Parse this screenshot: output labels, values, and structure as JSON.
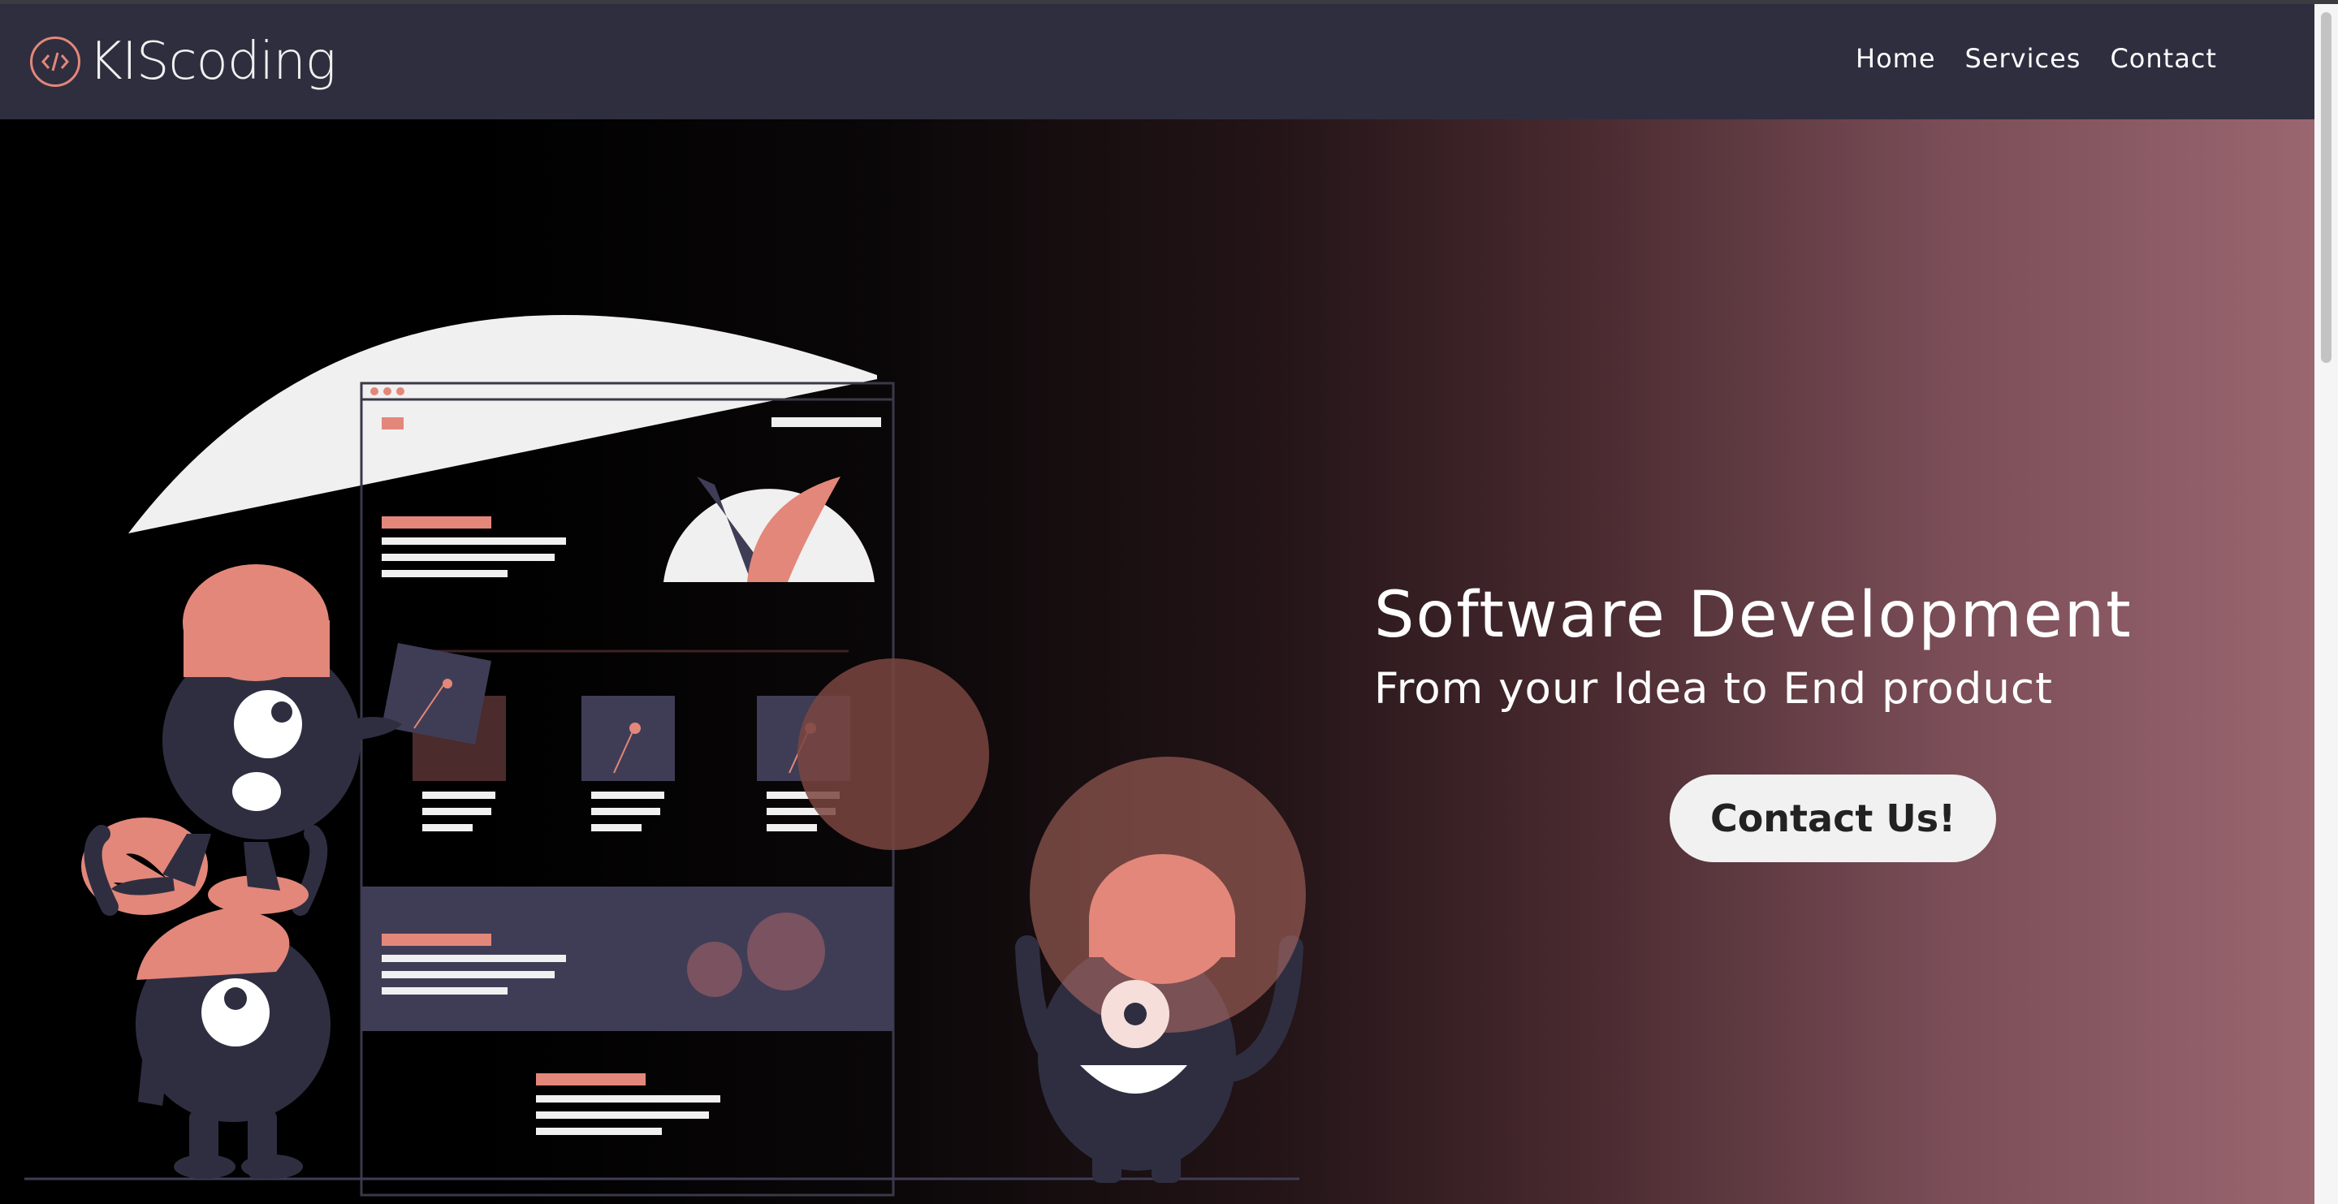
{
  "brand": {
    "name": "KIScoding",
    "icon": "code-brackets-icon",
    "accent": "#e3877a"
  },
  "nav": {
    "items": [
      "Home",
      "Services",
      "Contact"
    ]
  },
  "hero": {
    "title": "Software Development",
    "subtitle": "From your Idea to End product",
    "cta_label": "Contact Us!"
  },
  "colors": {
    "navbar": "#2f2e3f",
    "coral": "#e3877a",
    "creature": "#2f2e41",
    "gradient_start": "#000000",
    "gradient_end": "#9a6670"
  }
}
